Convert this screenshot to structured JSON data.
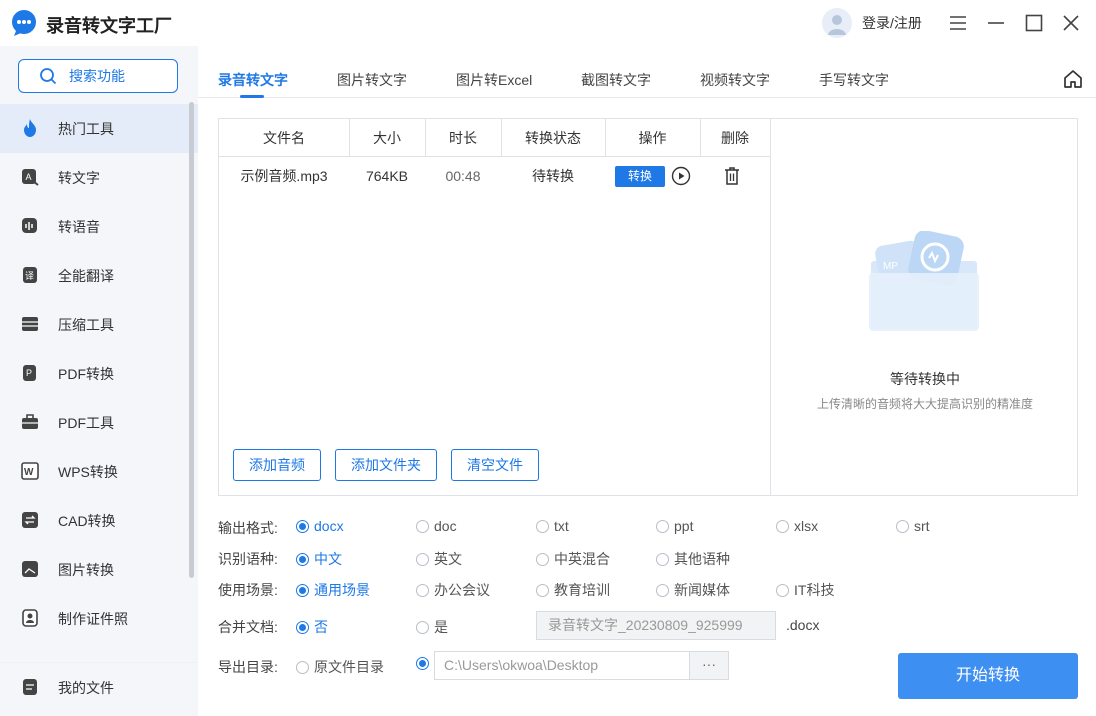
{
  "app": {
    "title": "录音转文字工厂",
    "login_label": "登录/注册"
  },
  "sidebar": {
    "search_label": "搜索功能",
    "items": [
      {
        "label": "热门工具",
        "icon": "flame-icon",
        "active": true
      },
      {
        "label": "转文字",
        "icon": "text-convert-icon"
      },
      {
        "label": "转语音",
        "icon": "voice-icon"
      },
      {
        "label": "全能翻译",
        "icon": "translate-icon"
      },
      {
        "label": "压缩工具",
        "icon": "compress-icon"
      },
      {
        "label": "PDF转换",
        "icon": "pdf-convert-icon"
      },
      {
        "label": "PDF工具",
        "icon": "toolbox-icon"
      },
      {
        "label": "WPS转换",
        "icon": "wps-icon"
      },
      {
        "label": "CAD转换",
        "icon": "cad-icon"
      },
      {
        "label": "图片转换",
        "icon": "image-icon"
      },
      {
        "label": "制作证件照",
        "icon": "id-photo-icon"
      }
    ],
    "my_files": "我的文件"
  },
  "tabs": [
    {
      "label": "录音转文字",
      "active": true
    },
    {
      "label": "图片转文字"
    },
    {
      "label": "图片转Excel"
    },
    {
      "label": "截图转文字"
    },
    {
      "label": "视频转文字"
    },
    {
      "label": "手写转文字"
    }
  ],
  "table": {
    "headers": [
      "文件名",
      "大小",
      "时长",
      "转换状态",
      "操作",
      "删除"
    ],
    "rows": [
      {
        "name": "示例音频.mp3",
        "size": "764KB",
        "duration": "00:48",
        "status": "待转换",
        "action": "转换"
      }
    ]
  },
  "buttons": {
    "add_audio": "添加音频",
    "add_folder": "添加文件夹",
    "clear": "清空文件",
    "start": "开始转换"
  },
  "empty": {
    "title": "等待转换中",
    "subtitle": "上传清晰的音频将大大提高识别的精准度",
    "badge": "MP"
  },
  "options": {
    "format": {
      "label": "输出格式:",
      "choices": [
        "docx",
        "doc",
        "txt",
        "ppt",
        "xlsx",
        "srt"
      ],
      "selected": "docx"
    },
    "language": {
      "label": "识别语种:",
      "choices": [
        "中文",
        "英文",
        "中英混合",
        "其他语种"
      ],
      "selected": "中文"
    },
    "scene": {
      "label": "使用场景:",
      "choices": [
        "通用场景",
        "办公会议",
        "教育培训",
        "新闻媒体",
        "IT科技"
      ],
      "selected": "通用场景"
    },
    "merge": {
      "label": "合并文档:",
      "choices": [
        "否",
        "是"
      ],
      "selected": "否",
      "filename_placeholder": "录音转文字_20230809_925999",
      "ext": ".docx"
    },
    "export": {
      "label": "导出目录:",
      "choices": [
        "原文件目录"
      ],
      "path": "C:\\Users\\okwoa\\Desktop",
      "browse": "···"
    }
  },
  "colors": {
    "accent": "#1e78e6",
    "start_button": "#3d8ff2",
    "sidebar_bg": "#f4f6f9"
  }
}
